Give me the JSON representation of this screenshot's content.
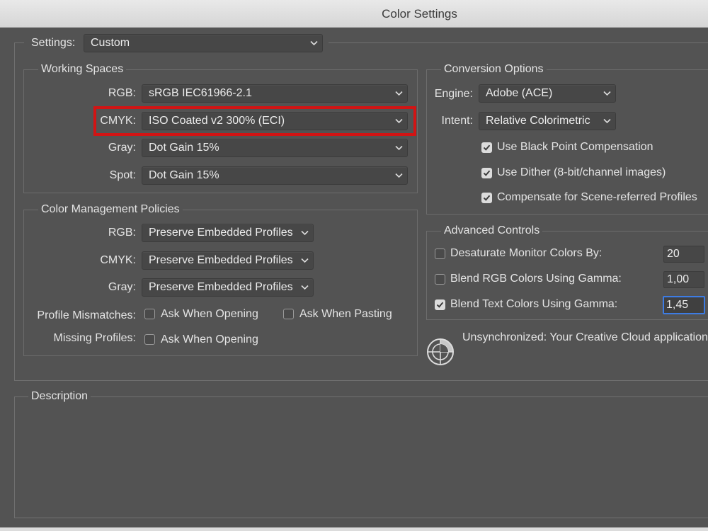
{
  "window": {
    "title": "Color Settings"
  },
  "settings": {
    "label": "Settings:",
    "value": "Custom"
  },
  "working_spaces": {
    "title": "Working Spaces",
    "rgb": {
      "label": "RGB:",
      "value": "sRGB IEC61966-2.1"
    },
    "cmyk": {
      "label": "CMYK:",
      "value": "ISO Coated v2 300% (ECI)"
    },
    "gray": {
      "label": "Gray:",
      "value": "Dot Gain 15%"
    },
    "spot": {
      "label": "Spot:",
      "value": "Dot Gain 15%"
    }
  },
  "policies": {
    "title": "Color Management Policies",
    "rgb": {
      "label": "RGB:",
      "value": "Preserve Embedded Profiles"
    },
    "cmyk": {
      "label": "CMYK:",
      "value": "Preserve Embedded Profiles"
    },
    "gray": {
      "label": "Gray:",
      "value": "Preserve Embedded Profiles"
    },
    "mismatch_label": "Profile Mismatches:",
    "mismatch_opening": {
      "label": "Ask When Opening",
      "checked": false
    },
    "mismatch_pasting": {
      "label": "Ask When Pasting",
      "checked": false
    },
    "missing_label": "Missing Profiles:",
    "missing_opening": {
      "label": "Ask When Opening",
      "checked": false
    }
  },
  "conversion": {
    "title": "Conversion Options",
    "engine": {
      "label": "Engine:",
      "value": "Adobe (ACE)"
    },
    "intent": {
      "label": "Intent:",
      "value": "Relative Colorimetric"
    },
    "black_point": {
      "label": "Use Black Point Compensation",
      "checked": true
    },
    "dither": {
      "label": "Use Dither (8-bit/channel images)",
      "checked": true
    },
    "scene": {
      "label": "Compensate for Scene-referred Profiles",
      "checked": true
    }
  },
  "advanced": {
    "title": "Advanced Controls",
    "desaturate": {
      "label": "Desaturate Monitor Colors By:",
      "checked": false,
      "value": "20"
    },
    "blend_rgb": {
      "label": "Blend RGB Colors Using Gamma:",
      "checked": false,
      "value": "1,00"
    },
    "blend_text": {
      "label": "Blend Text Colors Using Gamma:",
      "checked": true,
      "value": "1,45"
    }
  },
  "sync": {
    "text": "Unsynchronized: Your Creative Cloud applications",
    "icon": "color-sync-icon"
  },
  "description": {
    "title": "Description"
  },
  "colors": {
    "highlight": "#d21414",
    "focus": "#3d7ce4",
    "panel": "#535353"
  }
}
